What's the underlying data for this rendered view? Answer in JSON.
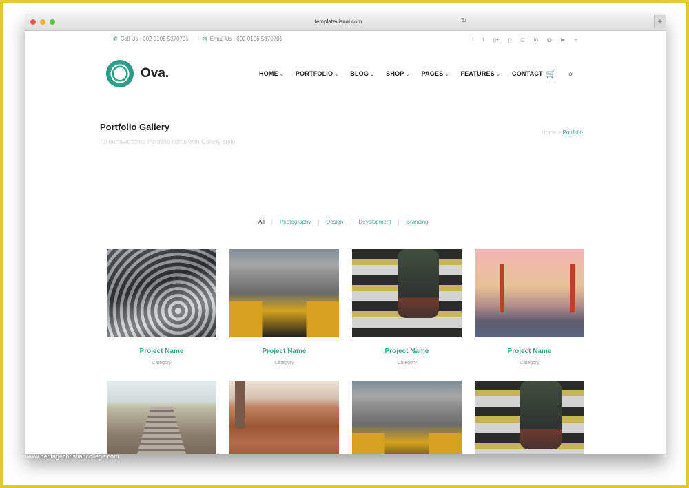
{
  "browser": {
    "url": "templatevisual.com"
  },
  "topbar": {
    "call": "Call Us : 002 0106 5370701",
    "email": "Email Us : 002 0106 5370701",
    "social_icons": [
      "facebook-icon",
      "twitter-icon",
      "google-plus-icon",
      "pinterest-icon",
      "instagram-icon",
      "linkedin-icon",
      "dribbble-icon",
      "youtube-icon",
      "rss-icon"
    ]
  },
  "brand": {
    "name": "Ova."
  },
  "nav": {
    "items": [
      "HOME",
      "PORTFOLIO",
      "BLOG",
      "SHOP",
      "PAGES",
      "FEATURES",
      "CONTACT"
    ]
  },
  "page": {
    "title": "Portfolio Gallery",
    "subtitle": "All our awesome Portfolio items with Gallery style",
    "breadcrumb": {
      "home": "Home",
      "sep": ">",
      "current": "Portfolio"
    }
  },
  "filters": {
    "items": [
      "All",
      "Photography",
      "Design",
      "Development",
      "Branding"
    ],
    "separator": "|"
  },
  "portfolio": {
    "items": [
      {
        "name": "Project Name",
        "category": "Category"
      },
      {
        "name": "Project Name",
        "category": "Category"
      },
      {
        "name": "Project Name",
        "category": "Category"
      },
      {
        "name": "Project Name",
        "category": "Category"
      }
    ]
  },
  "watermark": "www.heritagechristiancollege.com"
}
